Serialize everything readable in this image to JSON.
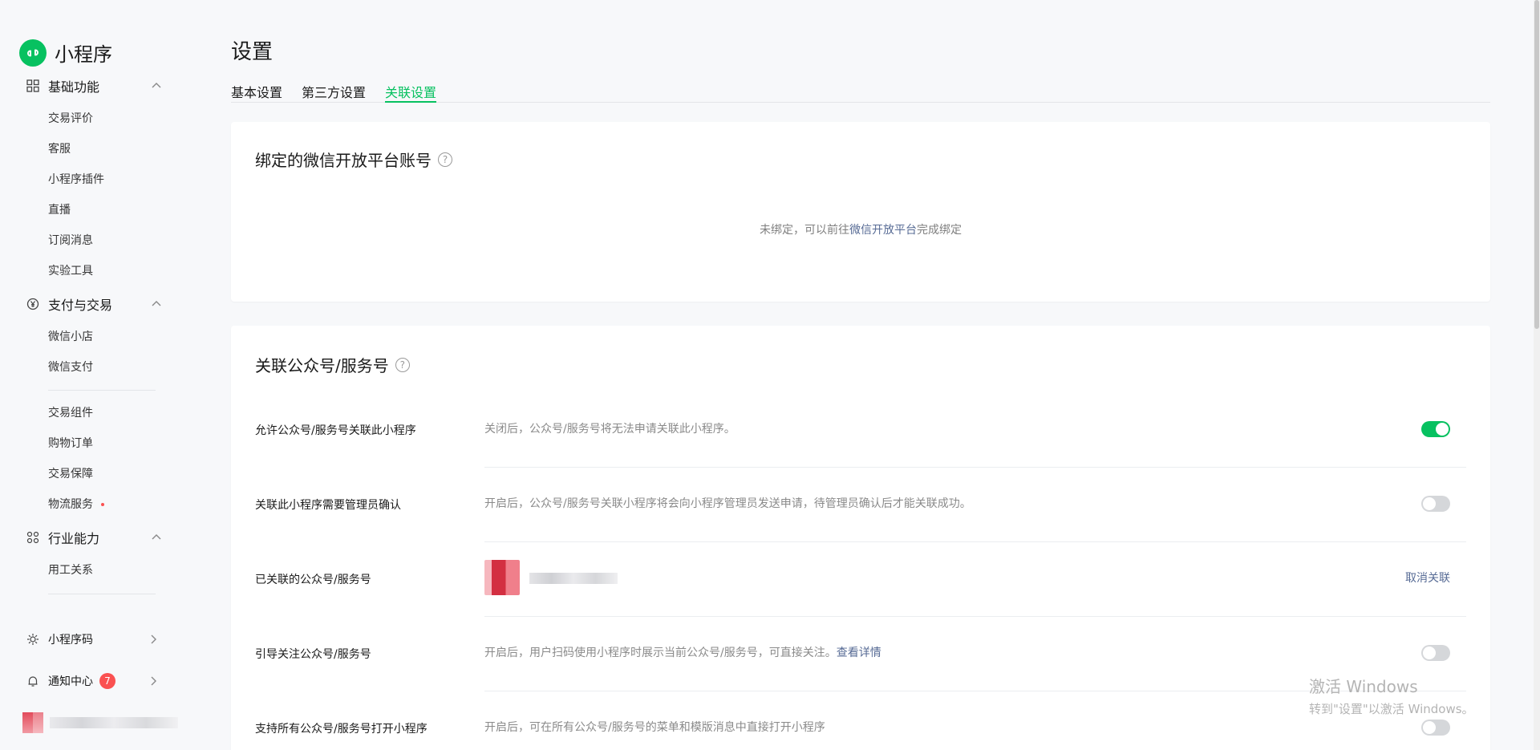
{
  "brand": {
    "title": "小程序"
  },
  "sidebar": {
    "groups": [
      {
        "label": "基础功能",
        "items": [
          "交易评价",
          "客服",
          "小程序插件",
          "直播",
          "订阅消息",
          "实验工具"
        ]
      },
      {
        "label": "支付与交易",
        "items": [
          "微信小店",
          "微信支付"
        ],
        "items2": [
          "交易组件",
          "购物订单",
          "交易保障",
          "物流服务"
        ]
      },
      {
        "label": "行业能力",
        "items": [
          "用工关系"
        ]
      }
    ],
    "bottom": {
      "qrcode": "小程序码",
      "notify": "通知中心",
      "notify_count": "7"
    }
  },
  "page": {
    "title": "设置",
    "tabs": [
      "基本设置",
      "第三方设置",
      "关联设置"
    ],
    "active_tab": "关联设置"
  },
  "card_platform": {
    "title": "绑定的微信开放平台账号",
    "help": "?",
    "status_prefix": "未绑定，可以前往",
    "status_link": "微信开放平台",
    "status_suffix": "完成绑定"
  },
  "card_official": {
    "title": "关联公众号/服务号",
    "help": "?",
    "rows": [
      {
        "label": "允许公众号/服务号关联此小程序",
        "desc": "关闭后，公众号/服务号将无法申请关联此小程序。",
        "toggle": "on"
      },
      {
        "label": "关联此小程序需要管理员确认",
        "desc": "开启后，公众号/服务号关联小程序将会向小程序管理员发送申请，待管理员确认后才能关联成功。",
        "toggle": "off"
      },
      {
        "label": "已关联的公众号/服务号",
        "action": "取消关联"
      },
      {
        "label": "引导关注公众号/服务号",
        "desc": "开启后，用户扫码使用小程序时展示当前公众号/服务号，可直接关注。",
        "link": "查看详情",
        "toggle": "off"
      },
      {
        "label": "支持所有公众号/服务号打开小程序",
        "desc": "开启后，可在所有公众号/服务号的菜单和模版消息中直接打开小程序",
        "toggle": "off"
      }
    ]
  },
  "watermark": {
    "line1": "激活 Windows",
    "line2": "转到\"设置\"以激活 Windows。"
  },
  "colors": {
    "accent": "#07c160",
    "link": "#576b95",
    "badge": "#fa5151"
  }
}
